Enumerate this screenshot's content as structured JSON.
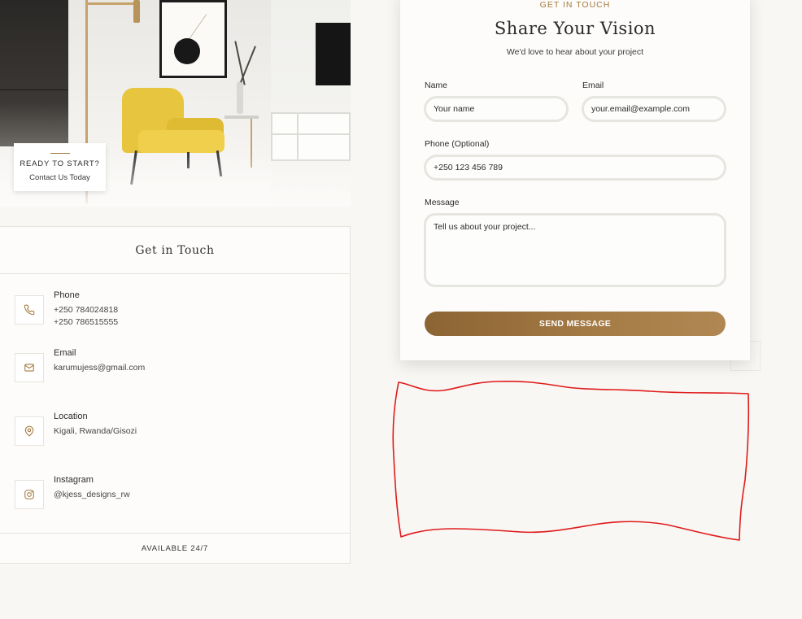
{
  "hero": {
    "card_title": "READY TO START?",
    "card_sub": "Contact Us Today"
  },
  "contact": {
    "title": "Get in Touch",
    "items": [
      {
        "icon": "phone-icon",
        "label": "Phone",
        "values": [
          "+250 784024818",
          "+250 786515555"
        ]
      },
      {
        "icon": "mail-icon",
        "label": "Email",
        "values": [
          "karumujess@gmail.com"
        ]
      },
      {
        "icon": "location-pin-icon",
        "label": "Location",
        "values": [
          "Kigali, Rwanda/Gisozi"
        ]
      },
      {
        "icon": "instagram-icon",
        "label": "Instagram",
        "values": [
          "@kjess_designs_rw"
        ]
      }
    ],
    "footer": "AVAILABLE 24/7"
  },
  "form": {
    "eyebrow": "GET IN TOUCH",
    "title": "Share Your Vision",
    "subtitle": "We'd love to hear about your project",
    "name_label": "Name",
    "name_placeholder": "Your name",
    "email_label": "Email",
    "email_placeholder": "your.email@example.com",
    "phone_label": "Phone (Optional)",
    "phone_placeholder": "+250 123 456 789",
    "message_label": "Message",
    "message_placeholder": "Tell us about your project...",
    "submit_label": "SEND MESSAGE"
  },
  "colors": {
    "accent": "#a4793e",
    "annotation": "#e01b1b"
  }
}
